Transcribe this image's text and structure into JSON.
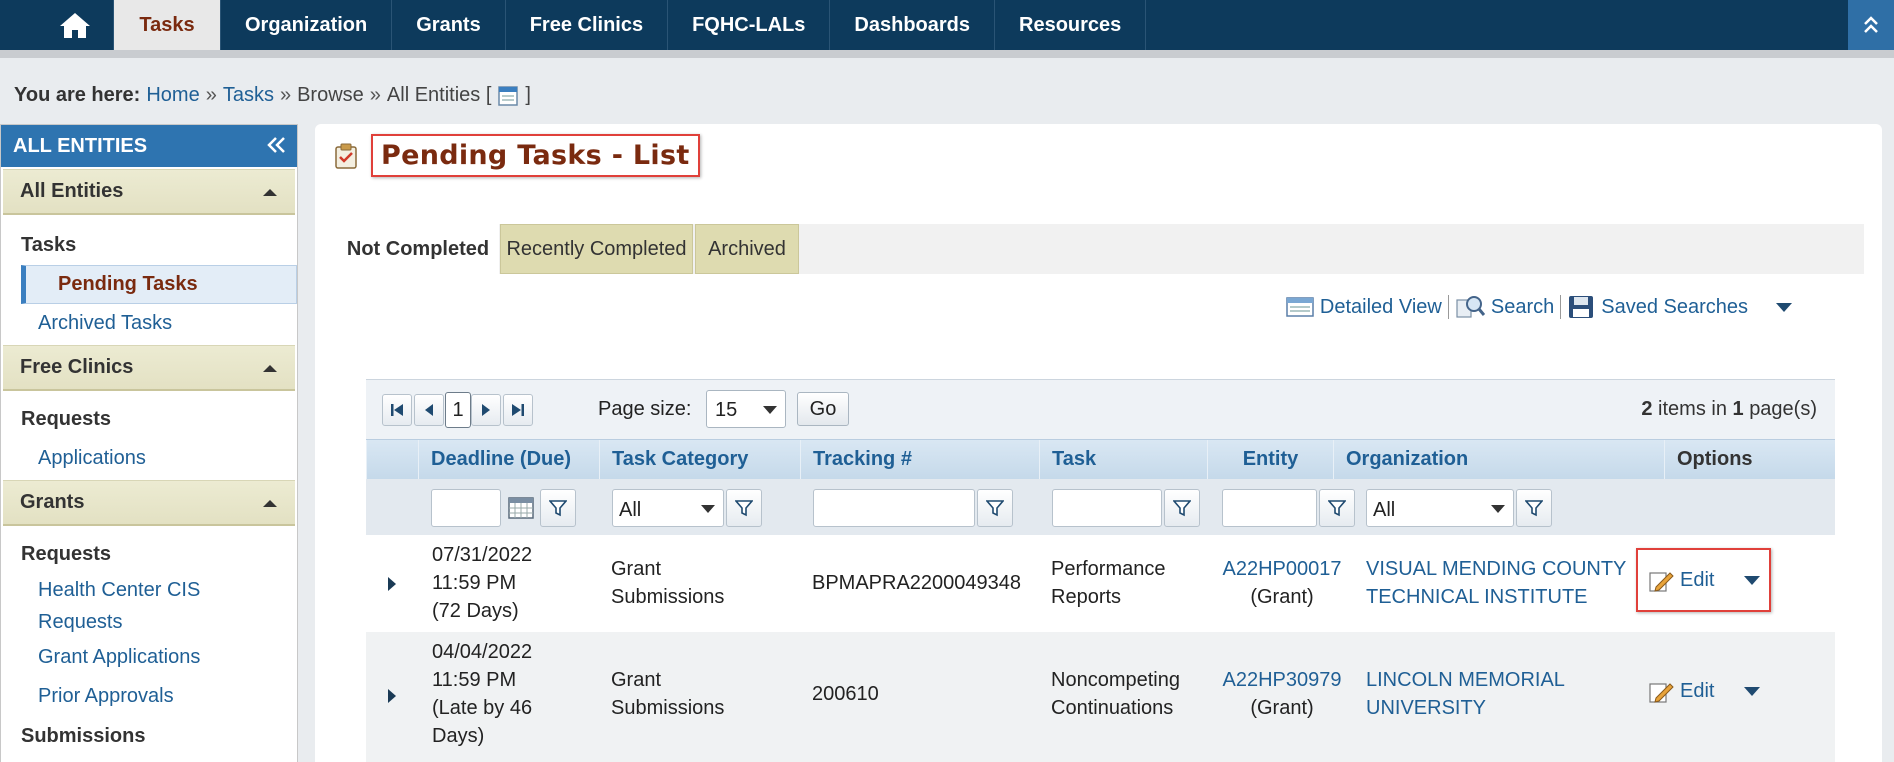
{
  "nav": {
    "tabs": [
      "Tasks",
      "Organization",
      "Grants",
      "Free Clinics",
      "FQHC-LALs",
      "Dashboards",
      "Resources"
    ],
    "active_tab": "Tasks"
  },
  "breadcrumb": {
    "label": "You are here:",
    "items": [
      "Home",
      "Tasks",
      "Browse",
      "All Entities ["
    ],
    "closing": "]"
  },
  "sidebar": {
    "header": "ALL ENTITIES",
    "sections": [
      {
        "title": "All Entities",
        "groups": [
          {
            "label": "Tasks",
            "items": [
              "Pending Tasks",
              "Archived Tasks"
            ]
          }
        ]
      },
      {
        "title": "Free Clinics",
        "groups": [
          {
            "label": "Requests",
            "items": [
              "Applications"
            ]
          }
        ]
      },
      {
        "title": "Grants",
        "groups": [
          {
            "label": "Requests",
            "items": [
              "Health Center CIS Requests",
              "Grant Applications",
              "Prior Approvals"
            ]
          },
          {
            "label": "Submissions",
            "items": []
          }
        ]
      }
    ],
    "selected_item": "Pending Tasks"
  },
  "main": {
    "title": "Pending Tasks - List",
    "tabs": [
      "Not Completed",
      "Recently Completed",
      "Archived"
    ],
    "active_tab": "Not Completed",
    "toolbar": {
      "detailed_view": "Detailed View",
      "search": "Search",
      "saved_searches": "Saved Searches"
    }
  },
  "grid": {
    "pager": {
      "current_page": "1",
      "page_size_label": "Page size:",
      "page_size": "15",
      "go": "Go",
      "items_count": "2",
      "items_text": "items in",
      "pages_count": "1",
      "pages_text": "page(s)"
    },
    "columns": [
      "Deadline (Due)",
      "Task Category",
      "Tracking #",
      "Task",
      "Entity",
      "Organization",
      "Options"
    ],
    "filters": {
      "task_category": "All",
      "organization": "All"
    },
    "rows": [
      {
        "deadline": [
          "07/31/2022",
          "11:59 PM",
          "(72 Days)"
        ],
        "category": [
          "Grant",
          "Submissions"
        ],
        "tracking": "BPMAPRA2200049348",
        "task": [
          "Performance",
          "Reports"
        ],
        "entity": "A22HP00017",
        "entity_type": "(Grant)",
        "organization": [
          "VISUAL MENDING COUNTY",
          "TECHNICAL INSTITUTE"
        ],
        "option": "Edit"
      },
      {
        "deadline": [
          "04/04/2022",
          "11:59 PM",
          "(Late by 46",
          "Days)"
        ],
        "category": [
          "Grant",
          "Submissions"
        ],
        "tracking": "200610",
        "task": [
          "Noncompeting",
          "Continuations"
        ],
        "entity": "A22HP30979",
        "entity_type": "(Grant)",
        "organization": [
          "LINCOLN MEMORIAL",
          "UNIVERSITY"
        ],
        "option": "Edit"
      }
    ]
  },
  "colors": {
    "nav_bg": "#0d3a5c",
    "active_accent": "#7a2a0f",
    "link": "#1f5f95",
    "highlight_box": "#e0403a",
    "sidebar_header": "#2e74b0"
  }
}
